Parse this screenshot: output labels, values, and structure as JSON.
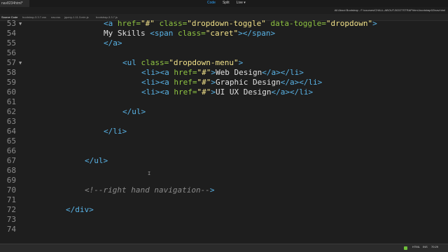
{
  "topbar": {
    "doc_tab": "nav8234html*",
    "view_buttons": [
      "Code",
      "Split",
      "Live"
    ],
    "active_view": "Code",
    "live_dropdown_glyph": "▾",
    "path": "All About Bootstrap - F:\\courses\\CHALL-ABOUT-BOOTSTRAP\\html-bootstrap02\\nav.html"
  },
  "files_bar": {
    "items": [
      "Source Code",
      "bootstrap-3.3.7.css",
      "nav.css",
      "jquery-1.11.3.min.js",
      "bootstrap-3.3.7.js"
    ],
    "active": "Source Code"
  },
  "editor": {
    "fold_glyph": "▼",
    "cursor_glyph": "I",
    "colors": {
      "tag": "#59b3e6",
      "attr": "#8fc442",
      "string": "#f2e28a",
      "text": "#e0e0e0",
      "comment": "#8a8a8a"
    },
    "lines": [
      {
        "num": "53",
        "fold": true,
        "tokens": [
          [
            "tag",
            "<a "
          ],
          [
            "attr",
            "href="
          ],
          [
            "str",
            "\"#\""
          ],
          [
            "attr",
            " class="
          ],
          [
            "str",
            "\"dropdown-toggle\""
          ],
          [
            "attr",
            " data-toggle="
          ],
          [
            "str",
            "\"dropdown\""
          ],
          [
            "tag",
            ">"
          ]
        ]
      },
      {
        "num": "54",
        "fold": false,
        "tokens": [
          [
            "text",
            "My Skills "
          ],
          [
            "tag",
            "<span "
          ],
          [
            "attr",
            "class="
          ],
          [
            "str",
            "\"caret\""
          ],
          [
            "tag",
            "></span>"
          ]
        ]
      },
      {
        "num": "55",
        "fold": false,
        "tokens": [
          [
            "tag",
            "</a>"
          ]
        ]
      },
      {
        "num": "56",
        "fold": false,
        "tokens": []
      },
      {
        "num": "57",
        "fold": true,
        "tokens": [
          [
            "tag",
            "<ul "
          ],
          [
            "attr",
            "class="
          ],
          [
            "str",
            "\"dropdown-menu\""
          ],
          [
            "tag",
            ">"
          ]
        ]
      },
      {
        "num": "58",
        "fold": false,
        "tokens": [
          [
            "tag",
            "<li><a "
          ],
          [
            "attr",
            "href="
          ],
          [
            "str",
            "\"#\""
          ],
          [
            "tag",
            ">"
          ],
          [
            "text",
            "Web Design"
          ],
          [
            "tag",
            "</a></li>"
          ]
        ]
      },
      {
        "num": "59",
        "fold": false,
        "tokens": [
          [
            "tag",
            "<li><a "
          ],
          [
            "attr",
            "href="
          ],
          [
            "str",
            "\"#\""
          ],
          [
            "tag",
            ">"
          ],
          [
            "text",
            "Graphic Design"
          ],
          [
            "tag",
            "</a></li>"
          ]
        ]
      },
      {
        "num": "60",
        "fold": false,
        "tokens": [
          [
            "tag",
            "<li><a "
          ],
          [
            "attr",
            "href="
          ],
          [
            "str",
            "\"#\""
          ],
          [
            "tag",
            ">"
          ],
          [
            "text",
            "UI UX Design"
          ],
          [
            "tag",
            "</a></li>"
          ]
        ]
      },
      {
        "num": "61",
        "fold": false,
        "tokens": []
      },
      {
        "num": "62",
        "fold": false,
        "tokens": [
          [
            "tag",
            "</ul>"
          ]
        ]
      },
      {
        "num": "63",
        "fold": false,
        "tokens": []
      },
      {
        "num": "64",
        "fold": false,
        "tokens": [
          [
            "tag",
            "</li>"
          ]
        ]
      },
      {
        "num": "65",
        "fold": false,
        "tokens": []
      },
      {
        "num": "66",
        "fold": false,
        "tokens": []
      },
      {
        "num": "67",
        "fold": false,
        "tokens": [
          [
            "tag",
            "</ul>"
          ]
        ]
      },
      {
        "num": "68",
        "fold": false,
        "tokens": []
      },
      {
        "num": "69",
        "fold": false,
        "tokens": []
      },
      {
        "num": "70",
        "fold": false,
        "tokens": [
          [
            "cmt",
            "<!--right hand navigation--"
          ],
          [
            "tag",
            ">"
          ]
        ]
      },
      {
        "num": "71",
        "fold": false,
        "tokens": []
      },
      {
        "num": "72",
        "fold": false,
        "tokens": [
          [
            "tag",
            "</div>"
          ]
        ]
      },
      {
        "num": "73",
        "fold": false,
        "tokens": []
      },
      {
        "num": "74",
        "fold": false,
        "tokens": []
      }
    ]
  },
  "status_bar": {
    "language": "HTML",
    "mode": "INS",
    "position": "70:29",
    "ok_color": "#6fbf3a"
  }
}
